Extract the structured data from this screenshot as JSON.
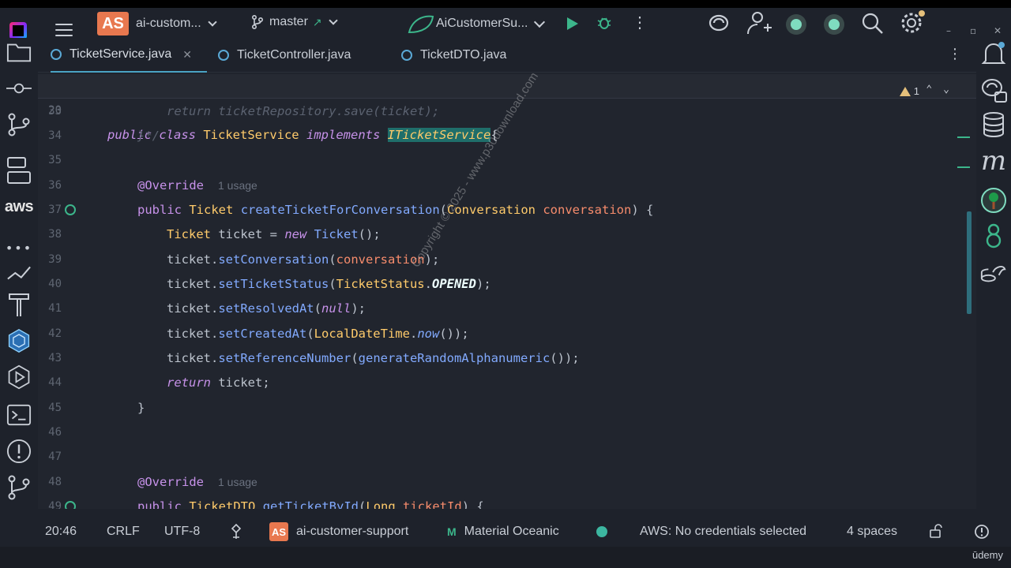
{
  "titlebar": {
    "project_badge": "AS",
    "project_name": "ai-custom...",
    "branch": "master",
    "branch_arrow": "↗",
    "run_config": "AiCustomerSu..."
  },
  "tabs": [
    {
      "label": "TicketService.java",
      "active": true,
      "closable": true
    },
    {
      "label": "TicketController.java",
      "active": false
    },
    {
      "label": "TicketDTO.java",
      "active": false
    }
  ],
  "editor": {
    "warning_count": "1",
    "sticky": {
      "ln": "20"
    },
    "lines": [
      {
        "ln": "33"
      },
      {
        "ln": "34"
      },
      {
        "ln": "35"
      },
      {
        "ln": "36",
        "usage": "1 usage"
      },
      {
        "ln": "37"
      },
      {
        "ln": "38"
      },
      {
        "ln": "39"
      },
      {
        "ln": "40"
      },
      {
        "ln": "41"
      },
      {
        "ln": "42"
      },
      {
        "ln": "43"
      },
      {
        "ln": "44"
      },
      {
        "ln": "45"
      },
      {
        "ln": "46"
      },
      {
        "ln": "47"
      },
      {
        "ln": "48",
        "usage": "1 usage"
      },
      {
        "ln": "49"
      }
    ]
  },
  "watermark": "Copyright © 2025 - www.p30download.com",
  "statusbar": {
    "position": "20:46",
    "line_ending": "CRLF",
    "encoding": "UTF-8",
    "module_badge": "AS",
    "module": "ai-customer-support",
    "theme": "Material Oceanic",
    "aws": "AWS: No credentials selected",
    "indent": "4 spaces"
  },
  "overlay": {
    "udemy": "ūdemy"
  },
  "icons": {
    "left": [
      "folder-icon",
      "commit-icon",
      "git-branch-icon",
      "structure-icon",
      "aws-icon",
      "more-icon",
      "endpoints-icon",
      "build-icon",
      "kubernetes-icon",
      "run-icon",
      "terminal-icon",
      "problems-icon",
      "git-icon"
    ],
    "right": [
      "notifications-icon",
      "ai-assistant-icon",
      "database-icon",
      "maven-icon",
      "spring-icon",
      "gradle-icon",
      "coverage-icon"
    ]
  },
  "colors": {
    "background": "#1e222b",
    "editor": "#21252e",
    "keyword": "#c792ea",
    "type": "#ffcb6b",
    "function": "#82aaff",
    "param": "#f78c6c",
    "accent": "#4aa3c4"
  }
}
